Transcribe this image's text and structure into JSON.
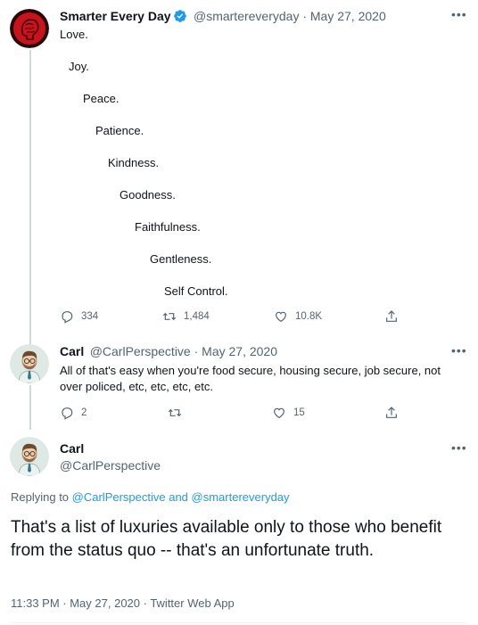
{
  "tweet1": {
    "name": "Smarter Every Day",
    "handle_date": "@smartereveryday · May 27, 2020",
    "lines": [
      "Love.",
      "Joy.",
      "Peace.",
      "Patience.",
      "Kindness.",
      "Goodness.",
      "Faithfulness.",
      "Gentleness.",
      "Self Control."
    ],
    "replies": "334",
    "retweets": "1,484",
    "likes": "10.8K"
  },
  "tweet2": {
    "name": "Carl",
    "handle_date": "@CarlPerspective · May 27, 2020",
    "text": "All of that's easy when you're food secure, housing secure, job secure, not over policed, etc, etc, etc, etc.",
    "replies": "2",
    "retweets": "",
    "likes": "15"
  },
  "main": {
    "name": "Carl",
    "handle": "@CarlPerspective",
    "replying_prefix": "Replying to ",
    "replying_user1": "@CarlPerspective",
    "replying_and": " and ",
    "replying_user2": "@smartereveryday",
    "text": "That's a list of luxuries available only to those who benefit from the status quo -- that's an unfortunate truth.",
    "timestamp": "11:33 PM · May 27, 2020 · Twitter Web App"
  },
  "colors": {
    "accent": "#1d9bf0",
    "muted": "#536471",
    "text": "#0f1419"
  }
}
